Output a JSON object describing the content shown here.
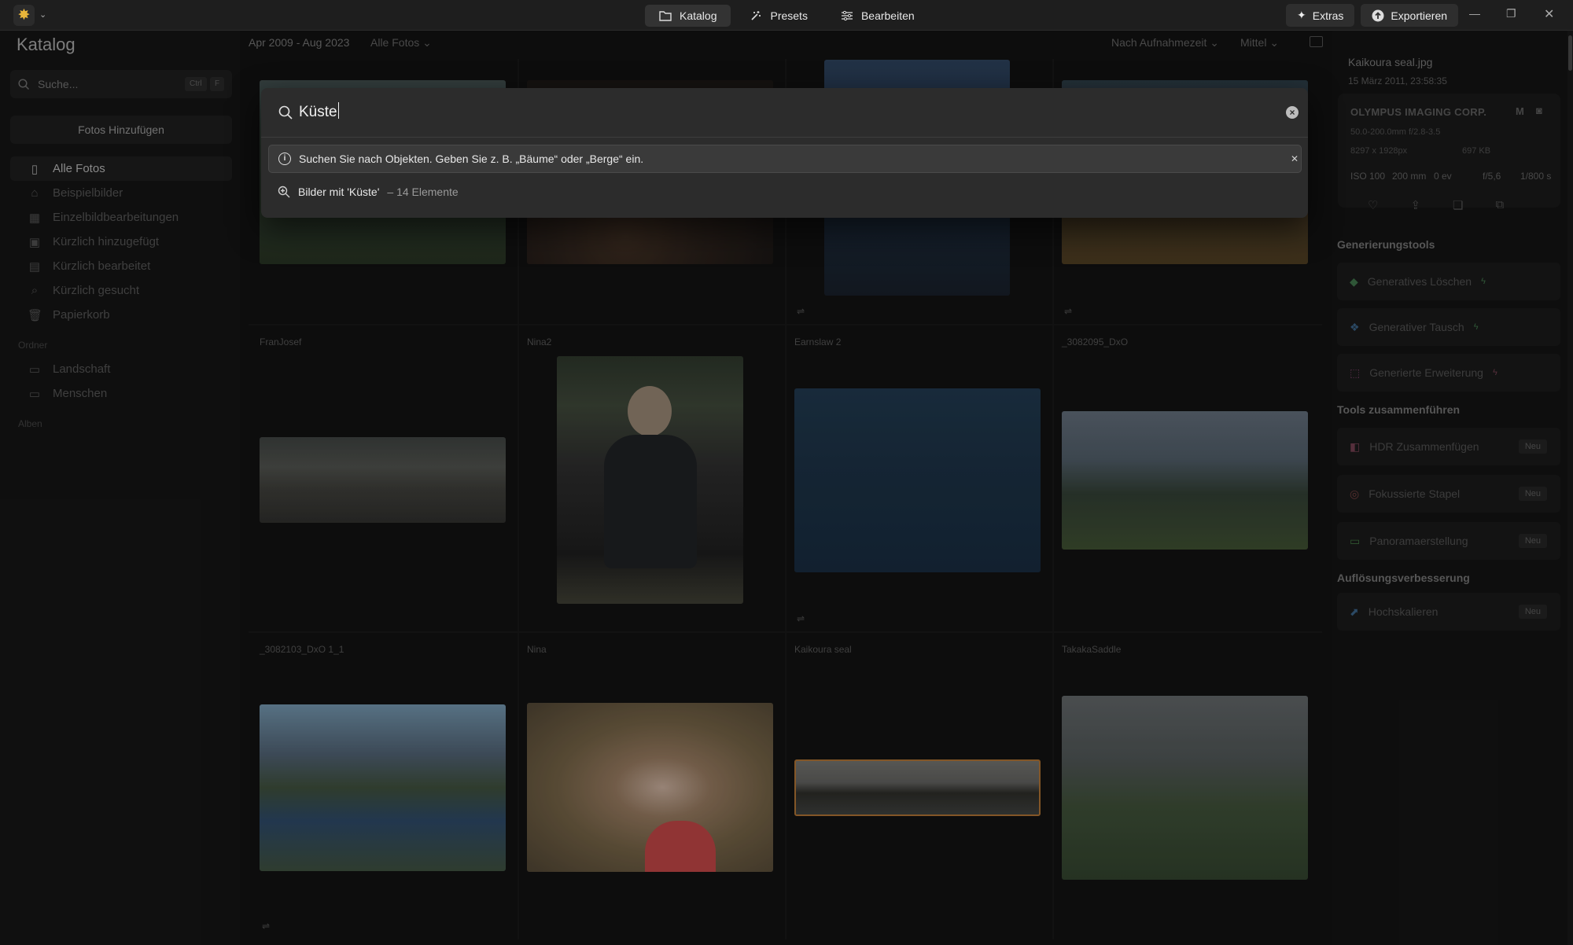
{
  "topbar": {
    "tabs": [
      {
        "label": "Katalog",
        "icon": "folder-icon",
        "active": true
      },
      {
        "label": "Presets",
        "icon": "magic-wand-icon",
        "active": false
      },
      {
        "label": "Bearbeiten",
        "icon": "sliders-icon",
        "active": false
      }
    ],
    "extras_label": "Extras",
    "export_label": "Exportieren"
  },
  "sidebar": {
    "title": "Katalog",
    "search_placeholder": "Suche...",
    "search_kbd": [
      "Ctrl",
      "F"
    ],
    "add_photos_label": "Fotos Hinzufügen",
    "items": [
      {
        "label": "Alle Fotos",
        "icon": "photos-icon",
        "active": true
      },
      {
        "label": "Beispielbilder",
        "icon": "graduation-cap-icon",
        "active": false
      },
      {
        "label": "Einzelbildbearbeitungen",
        "icon": "grid-icon",
        "active": false
      },
      {
        "label": "Kürzlich hinzugefügt",
        "icon": "image-plus-icon",
        "active": false
      },
      {
        "label": "Kürzlich bearbeitet",
        "icon": "image-edit-icon",
        "active": false
      },
      {
        "label": "Kürzlich gesucht",
        "icon": "search-icon",
        "active": false
      },
      {
        "label": "Papierkorb",
        "icon": "trash-icon",
        "active": false
      }
    ],
    "folders_heading": "Ordner",
    "folders": [
      {
        "label": "Landschaft",
        "icon": "folder-icon"
      },
      {
        "label": "Menschen",
        "icon": "folder-icon"
      }
    ],
    "albums_heading": "Alben"
  },
  "grid": {
    "date_range": "Apr 2009 - Aug 2023",
    "filter": "Alle Fotos",
    "sort": "Nach Aufnahmezeit",
    "size": "Mittel",
    "labels": [
      "FranJosef",
      "Nina2",
      "Earnslaw 2",
      "_3082095_DxO",
      "_3082103_DxO 1_1",
      "Nina",
      "Kaikoura seal",
      "TakakaSaddle"
    ]
  },
  "info": {
    "filename": "Kaikoura seal.jpg",
    "date": "15 März 2011, 23:58:35",
    "camera": "OLYMPUS IMAGING CORP.",
    "mode": "M",
    "lens": "50.0-200.0mm f/2.8-3.5",
    "dimensions": "8297 x 1928px",
    "filesize": "697 KB",
    "iso": "ISO 100",
    "focal": "200 mm",
    "ev": "0 ev",
    "aperture": "f/5,6",
    "shutter": "1/800 s"
  },
  "tools": {
    "gen_heading": "Generierungstools",
    "gen_items": [
      "Generatives Löschen",
      "Generativer Tausch",
      "Generierte Erweiterung"
    ],
    "merge_heading": "Tools zusammenführen",
    "merge_items": [
      "HDR Zusammenfügen",
      "Fokussierte Stapel",
      "Panoramaerstellung"
    ],
    "res_heading": "Auflösungsverbesserung",
    "res_items": [
      "Hochskalieren"
    ],
    "badge": "Neu"
  },
  "search": {
    "query": "Küste",
    "hint": "Suchen Sie nach Objekten. Geben Sie z. B. „Bäume“ oder „Berge“ ein.",
    "result_label": "Bilder mit 'Küste'",
    "result_count": "– 14 Elemente"
  }
}
